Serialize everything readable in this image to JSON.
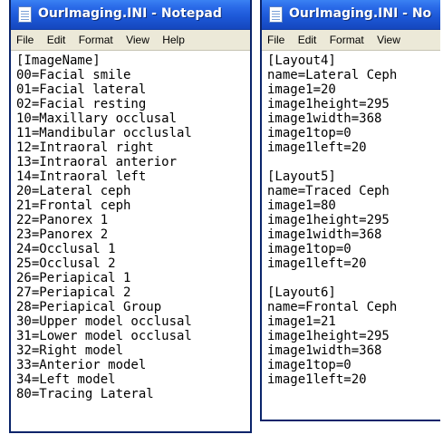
{
  "left_window": {
    "title": "OurImaging.INI - Notepad",
    "menu": [
      "File",
      "Edit",
      "Format",
      "View",
      "Help"
    ],
    "lines": [
      "[ImageName]",
      "00=Facial smile",
      "01=Facial lateral",
      "02=Facial resting",
      "10=Maxillary occlusal",
      "11=Mandibular occluslal",
      "12=Intraoral right",
      "13=Intraoral anterior",
      "14=Intraoral left",
      "20=Lateral ceph",
      "21=Frontal ceph",
      "22=Panorex 1",
      "23=Panorex 2",
      "24=Occlusal 1",
      "25=Occlusal 2",
      "26=Periapical 1",
      "27=Periapical 2",
      "28=Periapical Group",
      "30=Upper model occlusal",
      "31=Lower model occlusal",
      "32=Right model",
      "33=Anterior model",
      "34=Left model",
      "80=Tracing Lateral"
    ]
  },
  "right_window": {
    "title": "OurImaging.INI - No",
    "menu": [
      "File",
      "Edit",
      "Format",
      "View"
    ],
    "lines": [
      "[Layout4]",
      "name=Lateral Ceph",
      "image1=20",
      "image1height=295",
      "image1width=368",
      "image1top=0",
      "image1left=20",
      "",
      "[Layout5]",
      "name=Traced Ceph",
      "image1=80",
      "image1height=295",
      "image1width=368",
      "image1top=0",
      "image1left=20",
      "",
      "[Layout6]",
      "name=Frontal Ceph",
      "image1=21",
      "image1height=295",
      "image1width=368",
      "image1top=0",
      "image1left=20"
    ]
  },
  "colors": {
    "titlebar": "#2a6ae8",
    "menubar": "#ece9d8",
    "frame": "#0a246a"
  },
  "icons": {
    "title_icon": "notepad-icon"
  }
}
